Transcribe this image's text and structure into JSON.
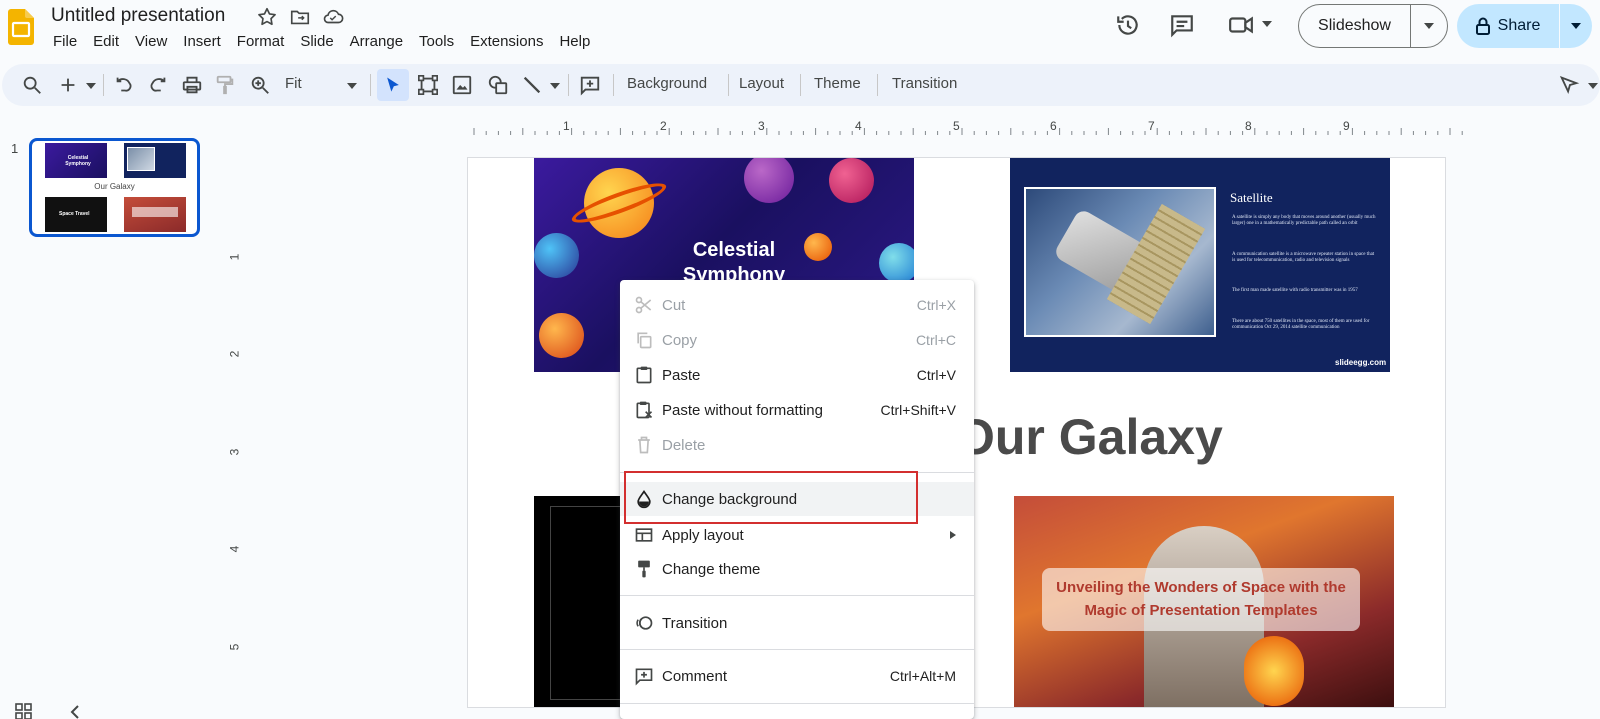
{
  "header": {
    "doc_title": "Untitled presentation",
    "menu": [
      "File",
      "Edit",
      "View",
      "Insert",
      "Format",
      "Slide",
      "Arrange",
      "Tools",
      "Extensions",
      "Help"
    ],
    "slideshow_label": "Slideshow",
    "share_label": "Share"
  },
  "toolbar": {
    "zoom": "Fit",
    "background": "Background",
    "layout": "Layout",
    "theme": "Theme",
    "transition": "Transition"
  },
  "filmstrip": {
    "slide_number": "1",
    "thumb_title": "Our Galaxy",
    "thumb_t1": "Celestial Symphony",
    "thumb_t3": "Space Travel"
  },
  "ruler": {
    "top_numbers": [
      "1",
      "2",
      "3",
      "4",
      "5",
      "6",
      "7",
      "8",
      "9"
    ],
    "left_numbers": [
      "1",
      "2",
      "3",
      "4",
      "5"
    ]
  },
  "slide": {
    "title": "Our Galaxy",
    "celestial": "Celestial Symphony",
    "satellite_title": "Satellite",
    "satellite_bullets": [
      "A satellite is simply any body that moves around another (usually much larger) one in a mathematically predictable path called an orbit",
      "A communication satellite is a microwave repeater station in space that is used for telecommunication, radio and television signals",
      "The first man made satellite with radio transmitter was in 1957",
      "There are about 750 satellites in the space, most of them are used for communication Oct 29, 2014 satellite communication"
    ],
    "slideegg": "slideegg.com",
    "unveil": "Unveiling the Wonders of Space with the Magic of Presentation Templates"
  },
  "context_menu": {
    "items": [
      {
        "label": "Cut",
        "shortcut": "Ctrl+X",
        "icon": "scissors-icon",
        "disabled": true
      },
      {
        "label": "Copy",
        "shortcut": "Ctrl+C",
        "icon": "copy-icon",
        "disabled": true
      },
      {
        "label": "Paste",
        "shortcut": "Ctrl+V",
        "icon": "clipboard-icon",
        "disabled": false
      },
      {
        "label": "Paste without formatting",
        "shortcut": "Ctrl+Shift+V",
        "icon": "clipboard-clear-icon",
        "disabled": false
      },
      {
        "label": "Delete",
        "shortcut": "",
        "icon": "trash-icon",
        "disabled": true
      },
      {
        "label": "Change background",
        "shortcut": "",
        "icon": "fill-drop-icon",
        "disabled": false
      },
      {
        "label": "Apply layout",
        "shortcut": "",
        "icon": "layout-icon",
        "disabled": false
      },
      {
        "label": "Change theme",
        "shortcut": "",
        "icon": "paint-roller-icon",
        "disabled": false
      },
      {
        "label": "Transition",
        "shortcut": "",
        "icon": "transition-icon",
        "disabled": false
      },
      {
        "label": "Comment",
        "shortcut": "Ctrl+Alt+M",
        "icon": "add-comment-icon",
        "disabled": false
      }
    ]
  },
  "colors": {
    "accent": "#0b57d0",
    "share_bg": "#c2e7ff",
    "highlight_box": "#d32f2f"
  }
}
